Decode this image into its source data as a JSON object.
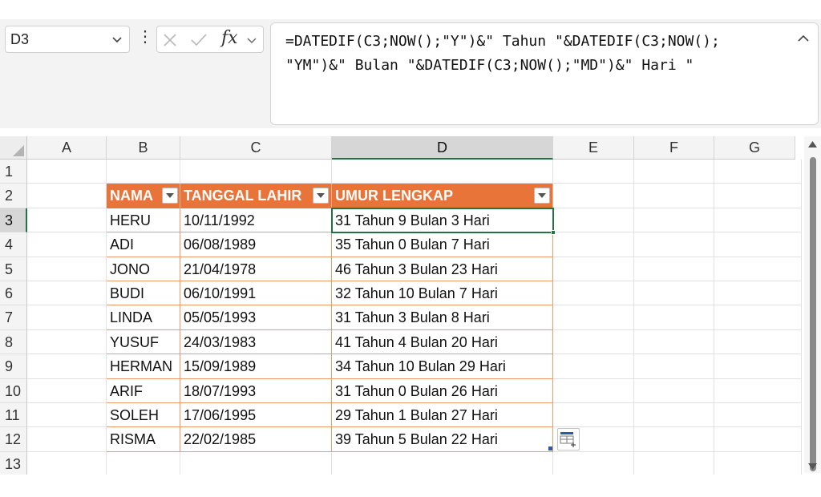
{
  "colors": {
    "accent": "#217346",
    "table_header": "#e9743a",
    "table_border": "#ee9a6a"
  },
  "name_box": {
    "value": "D3",
    "icon": "chevron-down-icon"
  },
  "formula_bar": {
    "options_icon": "more-vertical-icon",
    "cancel_icon": "close-icon",
    "enter_icon": "check-icon",
    "insert_function_label": "fx",
    "formula": "=DATEDIF(C3;NOW();\"Y\")&\" Tahun \"&DATEDIF(C3;NOW(); \"YM\")&\" Bulan \"&DATEDIF(C3;NOW();\"MD\")&\" Hari \"",
    "collapse_icon": "chevron-up-icon"
  },
  "sheet": {
    "columns": [
      "A",
      "B",
      "C",
      "D",
      "E",
      "F",
      "G"
    ],
    "rows": [
      "1",
      "2",
      "3",
      "4",
      "5",
      "6",
      "7",
      "8",
      "9",
      "10",
      "11",
      "12",
      "13"
    ],
    "active_cell": "D3",
    "table": {
      "headers": [
        "NAMA",
        "TANGGAL LAHIR",
        "UMUR LENGKAP"
      ],
      "filter_icon": "filter-dropdown-icon",
      "rows": [
        [
          "HERU",
          "10/11/1992",
          "31 Tahun 9 Bulan 3 Hari"
        ],
        [
          "ADI",
          "06/08/1989",
          "35 Tahun 0 Bulan 7 Hari"
        ],
        [
          "JONO",
          "21/04/1978",
          "46 Tahun 3 Bulan 23 Hari"
        ],
        [
          "BUDI",
          "06/10/1991",
          "32 Tahun 10 Bulan 7 Hari"
        ],
        [
          "LINDA",
          "05/05/1993",
          "31 Tahun 3 Bulan 8 Hari"
        ],
        [
          "YUSUF",
          "24/03/1983",
          "41 Tahun 4 Bulan 20 Hari"
        ],
        [
          "HERMAN",
          "15/09/1989",
          "34 Tahun 10 Bulan 29 Hari"
        ],
        [
          "ARIF",
          "18/07/1993",
          "31 Tahun 0 Bulan 26 Hari"
        ],
        [
          "SOLEH",
          "17/06/1995",
          "29 Tahun 1 Bulan 27 Hari"
        ],
        [
          "RISMA",
          "22/02/1985",
          "39 Tahun 5 Bulan 22 Hari"
        ]
      ]
    },
    "quick_analysis_icon": "quick-analysis-icon"
  },
  "scrollbar": {
    "up_icon": "scroll-up-arrow-icon",
    "down_icon": "scroll-down-arrow-icon"
  }
}
